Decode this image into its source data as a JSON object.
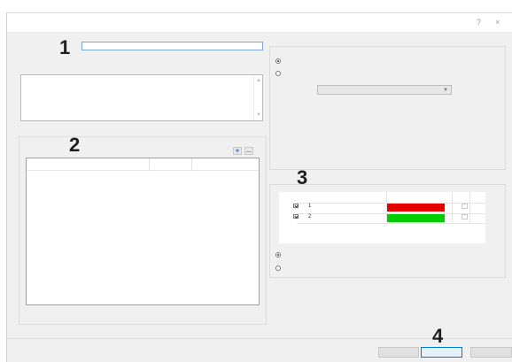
{
  "window": {
    "help_glyph": "?",
    "close_glyph": "×"
  },
  "markers": {
    "m1": "1",
    "m2": "2",
    "m3": "3",
    "m4": "4"
  },
  "name_input": {
    "value": ""
  },
  "description_box": {
    "value": ""
  },
  "list_toolbar": {
    "add_glyph": "+"
  },
  "color_rows": [
    {
      "label": "1",
      "checked": true,
      "color": "#e60000"
    },
    {
      "label": "2",
      "checked": true,
      "color": "#00cc00"
    }
  ],
  "colors": {
    "accent": "#0078d7",
    "red": "#e60000",
    "green": "#00cc00"
  }
}
